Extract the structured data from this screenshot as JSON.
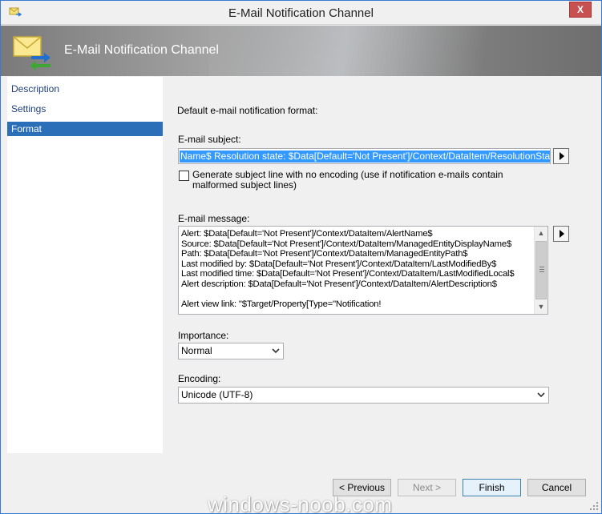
{
  "window": {
    "title": "E-Mail Notification Channel",
    "close_glyph": "X"
  },
  "banner": {
    "title": "E-Mail Notification Channel",
    "icon": "envelope-arrows-icon"
  },
  "nav": {
    "items": [
      {
        "label": "Description",
        "selected": false
      },
      {
        "label": "Settings",
        "selected": false
      },
      {
        "label": "Format",
        "selected": true
      }
    ]
  },
  "format": {
    "heading": "Default e-mail notification format:",
    "subject_label": "E-mail subject:",
    "subject_value": "Name$ Resolution state: $Data[Default='Not Present']/Context/DataItem/ResolutionStateName$",
    "checkbox_label": "Generate subject line with no encoding (use if notification e-mails contain malformed subject lines)",
    "checkbox_checked": false,
    "message_label": "E-mail message:",
    "message_lines": [
      "Alert: $Data[Default='Not Present']/Context/DataItem/AlertName$",
      "Source: $Data[Default='Not Present']/Context/DataItem/ManagedEntityDisplayName$",
      "Path: $Data[Default='Not Present']/Context/DataItem/ManagedEntityPath$",
      "Last modified by: $Data[Default='Not Present']/Context/DataItem/LastModifiedBy$",
      "Last modified time: $Data[Default='Not Present']/Context/DataItem/LastModifiedLocal$",
      "Alert description: $Data[Default='Not Present']/Context/DataItem/AlertDescription$",
      "",
      "Alert view link: \"$Target/Property[Type=\"Notification!"
    ],
    "importance_label": "Importance:",
    "importance_value": "Normal",
    "encoding_label": "Encoding:",
    "encoding_value": "Unicode (UTF-8)"
  },
  "footer": {
    "previous": "< Previous",
    "next": "Next >",
    "finish": "Finish",
    "cancel": "Cancel"
  },
  "watermark": "windows-noob.com"
}
